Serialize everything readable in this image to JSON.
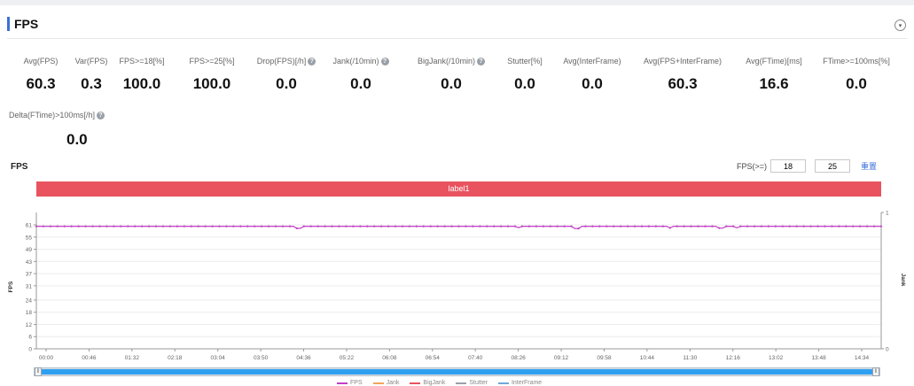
{
  "header": {
    "title": "FPS",
    "collapse_icon": "chevron-down-icon"
  },
  "metrics": [
    {
      "label": "Avg(FPS)",
      "value": "60.3",
      "help": false
    },
    {
      "label": "Var(FPS)",
      "value": "0.3",
      "help": false
    },
    {
      "label": "FPS>=18[%]",
      "value": "100.0",
      "help": false
    },
    {
      "label": "FPS>=25[%]",
      "value": "100.0",
      "help": false
    },
    {
      "label": "Drop(FPS)[/h]",
      "value": "0.0",
      "help": true
    },
    {
      "label": "Jank(/10min)",
      "value": "0.0",
      "help": true
    },
    {
      "label": "BigJank(/10min)",
      "value": "0.0",
      "help": true
    },
    {
      "label": "Stutter[%]",
      "value": "0.0",
      "help": false
    },
    {
      "label": "Avg(InterFrame)",
      "value": "0.0",
      "help": false
    },
    {
      "label": "Avg(FPS+InterFrame)",
      "value": "60.3",
      "help": false
    },
    {
      "label": "Avg(FTime)[ms]",
      "value": "16.6",
      "help": false
    },
    {
      "label": "FTime>=100ms[%]",
      "value": "0.0",
      "help": false
    },
    {
      "label": "Delta(FTime)>100ms[/h]",
      "value": "0.0",
      "help": true
    }
  ],
  "chart_section": {
    "title": "FPS",
    "threshold_label": "FPS(>=)",
    "threshold_1": "18",
    "threshold_2": "25",
    "reset_label": "重置",
    "label_bar": "label1",
    "slider_handle_left": "⦀",
    "slider_handle_right": "⦀"
  },
  "colors": {
    "accent": "#3b6fd8",
    "label_bar": "#e8535f",
    "fps_line": "#c23fc6",
    "slider": "#2fa0f0"
  },
  "chart_data": {
    "type": "line",
    "title": "",
    "xlabel": "",
    "ylabel": "FPS",
    "y2label": "Jank",
    "ylim": [
      0,
      61
    ],
    "y2lim": [
      0,
      1
    ],
    "yticks": [
      0,
      6,
      12,
      18,
      24,
      31,
      37,
      43,
      49,
      55,
      61
    ],
    "y2ticks": [
      0,
      1
    ],
    "xticks": [
      "00:00",
      "00:46",
      "01:32",
      "02:18",
      "03:04",
      "03:50",
      "04:36",
      "05:22",
      "06:08",
      "06:54",
      "07:40",
      "08:26",
      "09:12",
      "09:58",
      "10:44",
      "11:30",
      "12:16",
      "13:02",
      "13:48",
      "14:34"
    ],
    "x_range_seconds": [
      0,
      910
    ],
    "series": [
      {
        "name": "FPS",
        "color": "#c23fc6",
        "baseline": 60.3,
        "dips": [
          [
            0.31,
            59.3
          ],
          [
            0.57,
            59.6
          ],
          [
            0.64,
            59.2
          ],
          [
            0.75,
            59.5
          ],
          [
            0.81,
            59.4
          ],
          [
            0.83,
            59.5
          ]
        ]
      },
      {
        "name": "Jank",
        "color": "#f2a65a",
        "values": []
      },
      {
        "name": "BigJank",
        "color": "#e8535f",
        "values": []
      },
      {
        "name": "Stutter",
        "color": "#9aa0a8",
        "values": []
      },
      {
        "name": "InterFrame",
        "color": "#6fa8dc",
        "values": []
      }
    ],
    "grid": "horizontal",
    "legend": "bottom-center"
  }
}
